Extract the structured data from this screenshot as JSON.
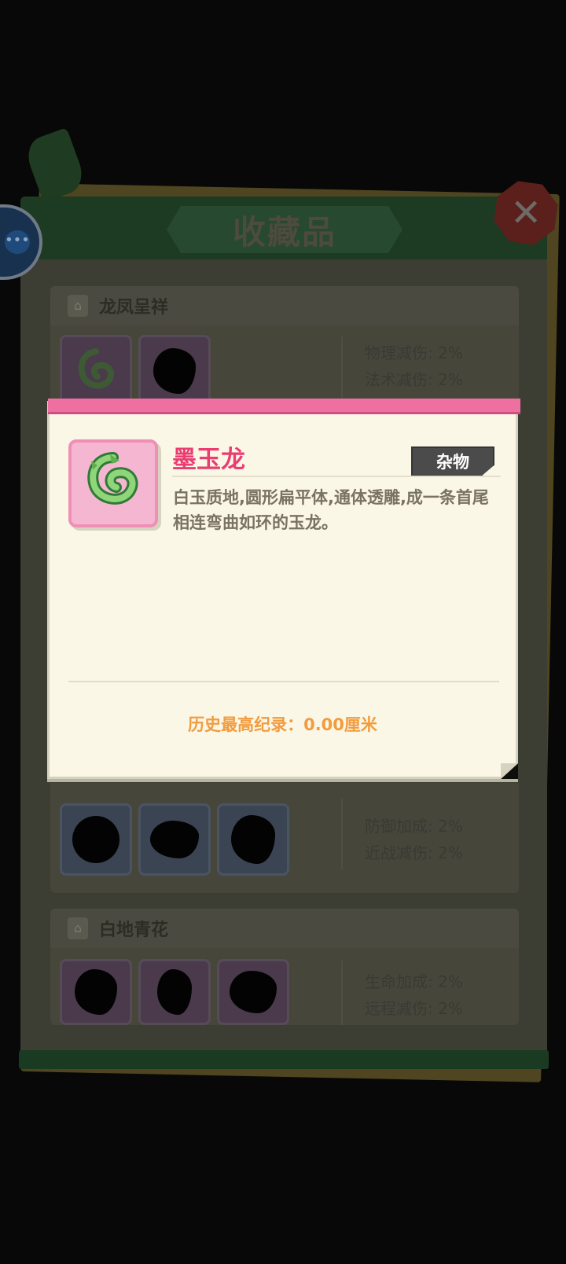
{
  "panel": {
    "title": "收藏品",
    "close_icon": "close-icon",
    "chat_icon": "chat-bubble-icon"
  },
  "sections": [
    {
      "name": "龙凤呈祥",
      "stats": [
        "物理减伤: 2%",
        "法术减伤: 2%"
      ]
    },
    {
      "name": "",
      "stats": [
        "防御加成: 2%",
        "近战减伤: 2%"
      ]
    },
    {
      "name": "白地青花",
      "stats": [
        "生命加成: 2%",
        "远程减伤: 2%"
      ]
    }
  ],
  "modal": {
    "item_name": "墨玉龙",
    "category": "杂物",
    "description": "白玉质地,圆形扁平体,通体透雕,成一条首尾相连弯曲如环的玉龙。",
    "record_label": "历史最高纪录：0.00厘米",
    "item_icon": "jade-dragon-icon"
  },
  "colors": {
    "accent_pink": "#ea3d72",
    "record_orange": "#f29c3e",
    "topbar_pink": "#ee70a1"
  }
}
